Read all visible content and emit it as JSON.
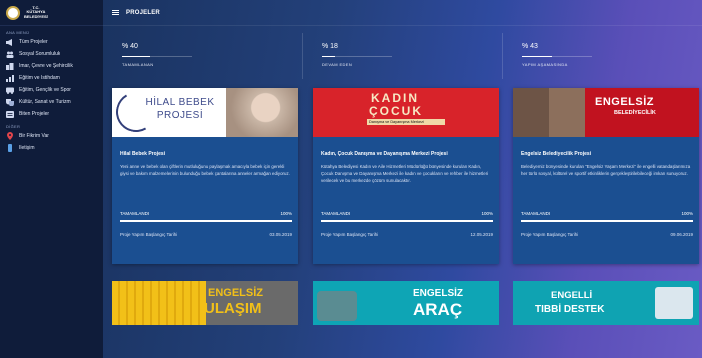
{
  "brand": {
    "logo_line1": "T.C.",
    "logo_line2": "KÜTAHYA",
    "logo_line3": "BELEDİYESİ"
  },
  "sidebar": {
    "main_label": "ANA MENÜ",
    "items": [
      {
        "label": "Tüm Projeler",
        "icon": "megaphone-icon"
      },
      {
        "label": "Sosyal Sorumluluk",
        "icon": "people-icon"
      },
      {
        "label": "İmar, Çevre ve Şehircilik",
        "icon": "building-icon"
      },
      {
        "label": "Eğitim ve İstihdam",
        "icon": "chart-icon"
      },
      {
        "label": "Eğitim, Gençlik ve Spor",
        "icon": "bus-icon"
      },
      {
        "label": "Kültür, Sanat ve Turizm",
        "icon": "theater-icon"
      },
      {
        "label": "Biten Projeler",
        "icon": "list-icon"
      }
    ],
    "other_label": "DİĞER",
    "other_items": [
      {
        "label": "Bir Fikrim Var",
        "icon": "location-icon"
      },
      {
        "label": "İletişim",
        "icon": "phone-icon"
      }
    ]
  },
  "header": {
    "title": "PROJELER"
  },
  "stats": [
    {
      "value": "% 40",
      "label": "TAMAMLANAN",
      "fraction": 0.4
    },
    {
      "value": "% 18",
      "label": "DEVAM EDEN",
      "fraction": 0.18
    },
    {
      "value": "% 43",
      "label": "YAPIM AŞAMASINDA",
      "fraction": 0.43
    }
  ],
  "cards": [
    {
      "image_title_line1": "HİLAL BEBEK",
      "image_title_line2": "PROJESİ",
      "title": "Hilal Bebek Projesi",
      "description": "Yeni anne ve bebek olan çiftlerin mutluluğunu paylaşmak amacıyla bebek için gerekli giysi ve bakım malzemelerinin bulunduğu bebek çantalarına anneler armağan ediyoruz.",
      "progress_label": "TAMAMLANDI",
      "progress_value": "100%",
      "progress_fraction": 1.0,
      "date_label": "Proje Yapım Başlangıç Tarihi",
      "date_value": "03.05.2019"
    },
    {
      "image_title_line1": "KADIN",
      "image_title_line2": "ÇOCUK",
      "image_subtitle": "Danışma ve Dayanışma Merkezi",
      "title": "Kadın, Çocuk Danışma ve Dayanışma Merkezi Projesi",
      "description": "Kütahya Belediyesi Kadın ve Aile Hizmetleri Müdürlüğü bünyesinde kurulan Kadın, Çocuk Danışma ve Dayanışma Merkezi ile kadın ve çocukların ve rehber ile hizmetleri verilecek ve bu merkezde çözüm sunulacaktır.",
      "progress_label": "TAMAMLANDI",
      "progress_value": "100%",
      "progress_fraction": 1.0,
      "date_label": "Proje Yapım Başlangıç Tarihi",
      "date_value": "12.05.2019"
    },
    {
      "image_title_line1": "ENGELSİZ",
      "image_title_line2": "BELEDİYECİLİK",
      "title": "Engelsiz Belediyecilik Projesi",
      "description": "Belediyemiz bünyesinde kurulan \"Engelsiz Yaşam Merkezi\" ile engelli vatandaşlarımıza her türlü sosyal, kültürel ve sportif etkinliklerin gerçekleştirilebileceği imkan sunuyoruz.",
      "progress_label": "TAMAMLANDI",
      "progress_value": "100%",
      "progress_fraction": 1.0,
      "date_label": "Proje Yapım Başlangıç Tarihi",
      "date_value": "09.06.2019"
    }
  ],
  "bottom_cards": [
    {
      "line1": "ENGELSİZ",
      "line2": "ULAŞIM"
    },
    {
      "line1": "ENGELSİZ",
      "line2": "ARAÇ"
    },
    {
      "line1": "ENGELLİ",
      "line2": "TIBBİ DESTEK"
    }
  ]
}
